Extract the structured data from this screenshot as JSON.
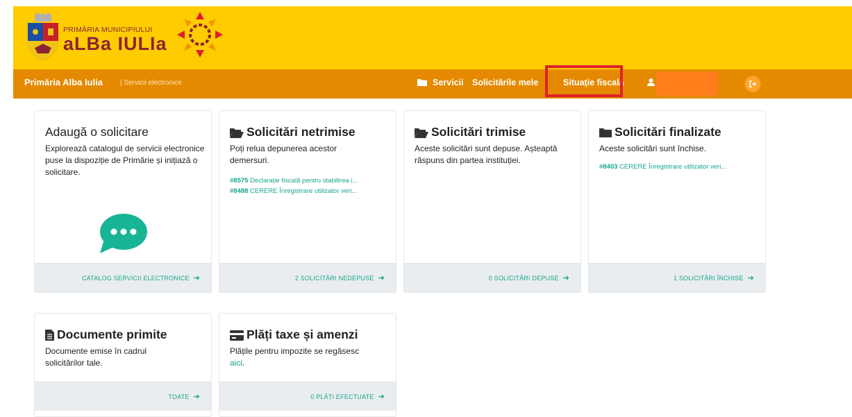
{
  "header": {
    "brand_small": "PRIMĂRIA MUNICIPIULUI",
    "brand_big": "aLBa IULIa"
  },
  "navbar": {
    "site_title": "Primăria Alba Iulia",
    "site_subtitle": "| Servicii electronice",
    "items": {
      "servicii": "Servicii",
      "solicitari": "Solicitările mele",
      "fiscal": "Situație fiscală",
      "user": "U"
    },
    "highlight_color": "#e0202a"
  },
  "cards": {
    "adauga": {
      "title": "Adaugă o solicitare",
      "desc": "Explorează catalogul de servicii electronice puse la dispoziție de Primărie și inițiază o solicitare.",
      "footer": "CATALOG SERVICII ELECTRONICE",
      "icon": "chat-bubble-icon"
    },
    "netrimise": {
      "title": "Solicitări netrimise",
      "desc": "Poți relua depunerea acestor demersuri.",
      "links": [
        {
          "id": "#8575",
          "text": "Declarație fiscală pentru stabilirea i..."
        },
        {
          "id": "#8488",
          "text": "CERERE Înregistrare utilizator veri..."
        }
      ],
      "footer": "2 SOLICITĂRI NEDEPUSE",
      "icon": "folder-open-icon"
    },
    "trimise": {
      "title": "Solicitări trimise",
      "desc": "Aceste solicitări sunt depuse. Așteaptă răspuns din partea instituției.",
      "footer": "0 SOLICITĂRI DEPUSE",
      "icon": "folder-open-icon"
    },
    "finalizate": {
      "title": "Solicitări finalizate",
      "desc": "Aceste solicitări sunt închise.",
      "links": [
        {
          "id": "#8403",
          "text": "CERERE Înregistrare utilizator veri..."
        }
      ],
      "footer": "1 SOLICITĂRI ÎNCHISE",
      "icon": "folder-icon"
    },
    "documente": {
      "title": "Documente primite",
      "desc": "Documente emise în cadrul solicitărilor tale.",
      "footer": "TOATE",
      "icon": "document-icon"
    },
    "plati": {
      "title": "Plăți taxe și amenzi",
      "desc": "Plățile pentru impozite se regăsesc",
      "desc_link": "aici",
      "footer": "0 PLĂȚI EFECTUATE",
      "icon": "credit-card-icon"
    }
  },
  "colors": {
    "yellow": "#ffcc00",
    "orange_nav": "#e58a00",
    "accent_green": "#17a589",
    "brand_red": "#8c2434"
  }
}
